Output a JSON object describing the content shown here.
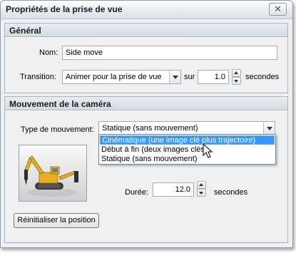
{
  "window": {
    "title": "Propriétés de la prise de vue",
    "close_glyph": "✕"
  },
  "general": {
    "header": "Général",
    "name_label": "Nom:",
    "name_value": "Side move",
    "transition_label": "Transition:",
    "transition_value": "Animer pour la prise de vue",
    "sur_label": "sur",
    "duration_value": "1.0",
    "seconds_label": "secondes"
  },
  "camera": {
    "header": "Mouvement de la caméra",
    "movement_type_label": "Type de mouvement:",
    "movement_type_value": "Statique (sans mouvement)",
    "dropdown_options": [
      "Cinématique (une image clé plus trajectoire)",
      "Début à fin (deux images clés)",
      "Statique (sans mouvement)"
    ],
    "highlighted_option_index": 0,
    "duree_label": "Durée:",
    "duree_value": "12.0",
    "duree_seconds_label": "secondes",
    "reset_button": "Réinitialiser la position",
    "thumbnail_icon": "excavator-thumbnail"
  },
  "colors": {
    "selection": "#3399ff",
    "machine_yellow": "#e8b020"
  }
}
